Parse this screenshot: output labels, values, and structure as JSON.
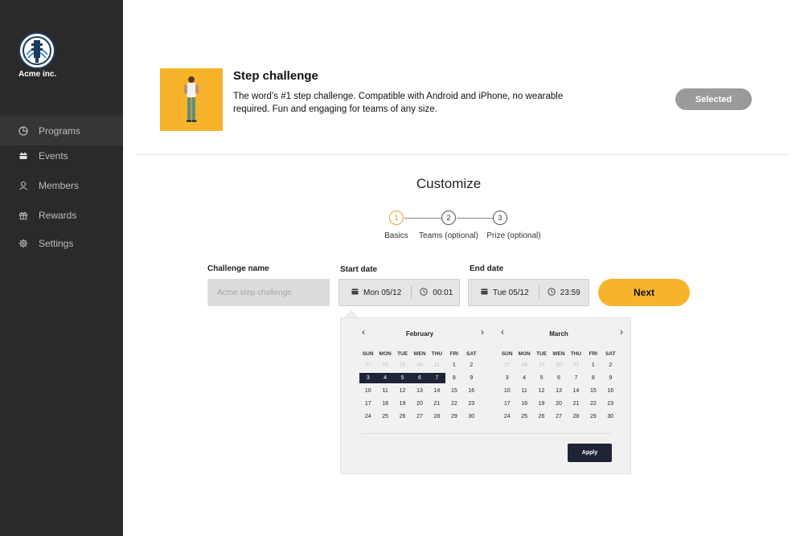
{
  "sidebar": {
    "brand_name": "Acme inc.",
    "items": [
      {
        "label": "Programs",
        "icon": "pie-chart-icon",
        "active": true
      },
      {
        "label": "Events",
        "icon": "calendar-icon",
        "active": false
      },
      {
        "label": "Members",
        "icon": "user-icon",
        "active": false
      },
      {
        "label": "Rewards",
        "icon": "gift-icon",
        "active": false
      },
      {
        "label": "Settings",
        "icon": "gear-icon",
        "active": false
      }
    ]
  },
  "program": {
    "title": "Step challenge",
    "description": "The word’s #1 step challenge. Compatible with Android and iPhone, no wearable required. Fun and engaging for teams of any size.",
    "status_button": "Selected"
  },
  "customize": {
    "title": "Customize",
    "steps": [
      {
        "number": "1",
        "label": "Basics",
        "active": true
      },
      {
        "number": "2",
        "label": "Teams (optional)",
        "active": false
      },
      {
        "number": "3",
        "label": "Prize (optional)",
        "active": false
      }
    ]
  },
  "form": {
    "challenge_name_label": "Challenge name",
    "challenge_name_placeholder": "Acme step challenge",
    "start_date_label": "Start date",
    "start_date": "Mon 05/12",
    "start_time": "00:01",
    "end_date_label": "End date",
    "end_date": "Tue 05/12",
    "end_time": "23:59",
    "next_label": "Next"
  },
  "calendar": {
    "prev_symbol": "‹",
    "next_symbol": "›",
    "weekdays": [
      "SUN",
      "MON",
      "TUE",
      "WEN",
      "THU",
      "FRI",
      "SAT"
    ],
    "months": [
      {
        "name": "February",
        "weeks": [
          [
            {
              "d": "27",
              "m": true
            },
            {
              "d": "28",
              "m": true
            },
            {
              "d": "29",
              "m": true
            },
            {
              "d": "30",
              "m": true
            },
            {
              "d": "31",
              "m": true
            },
            {
              "d": "1"
            },
            {
              "d": "2"
            }
          ],
          [
            {
              "d": "3",
              "r": true
            },
            {
              "d": "4",
              "r": true
            },
            {
              "d": "5",
              "r": true
            },
            {
              "d": "6",
              "r": true
            },
            {
              "d": "7",
              "r": true
            },
            {
              "d": "8"
            },
            {
              "d": "9"
            }
          ],
          [
            {
              "d": "10"
            },
            {
              "d": "11"
            },
            {
              "d": "12"
            },
            {
              "d": "13"
            },
            {
              "d": "14"
            },
            {
              "d": "15"
            },
            {
              "d": "16"
            }
          ],
          [
            {
              "d": "17"
            },
            {
              "d": "18"
            },
            {
              "d": "19"
            },
            {
              "d": "20"
            },
            {
              "d": "21"
            },
            {
              "d": "22"
            },
            {
              "d": "23"
            }
          ],
          [
            {
              "d": "24"
            },
            {
              "d": "25"
            },
            {
              "d": "26"
            },
            {
              "d": "27"
            },
            {
              "d": "28"
            },
            {
              "d": "29"
            },
            {
              "d": "30"
            }
          ]
        ]
      },
      {
        "name": "March",
        "weeks": [
          [
            {
              "d": "27",
              "m": true
            },
            {
              "d": "28",
              "m": true
            },
            {
              "d": "29",
              "m": true
            },
            {
              "d": "30",
              "m": true
            },
            {
              "d": "31",
              "m": true
            },
            {
              "d": "1"
            },
            {
              "d": "2"
            }
          ],
          [
            {
              "d": "3"
            },
            {
              "d": "4"
            },
            {
              "d": "5"
            },
            {
              "d": "6"
            },
            {
              "d": "7"
            },
            {
              "d": "8"
            },
            {
              "d": "9"
            }
          ],
          [
            {
              "d": "10"
            },
            {
              "d": "11"
            },
            {
              "d": "12"
            },
            {
              "d": "13"
            },
            {
              "d": "14"
            },
            {
              "d": "15"
            },
            {
              "d": "16"
            }
          ],
          [
            {
              "d": "17"
            },
            {
              "d": "18"
            },
            {
              "d": "19"
            },
            {
              "d": "20"
            },
            {
              "d": "21"
            },
            {
              "d": "22"
            },
            {
              "d": "23"
            }
          ],
          [
            {
              "d": "24"
            },
            {
              "d": "25"
            },
            {
              "d": "26"
            },
            {
              "d": "27"
            },
            {
              "d": "28"
            },
            {
              "d": "29"
            },
            {
              "d": "30"
            }
          ]
        ]
      }
    ],
    "apply_label": "Apply"
  },
  "colors": {
    "accent": "#f7b32b",
    "sidebar_bg": "#2a2a2a",
    "range_highlight": "#202437",
    "selected_button": "#9a9a9a"
  }
}
